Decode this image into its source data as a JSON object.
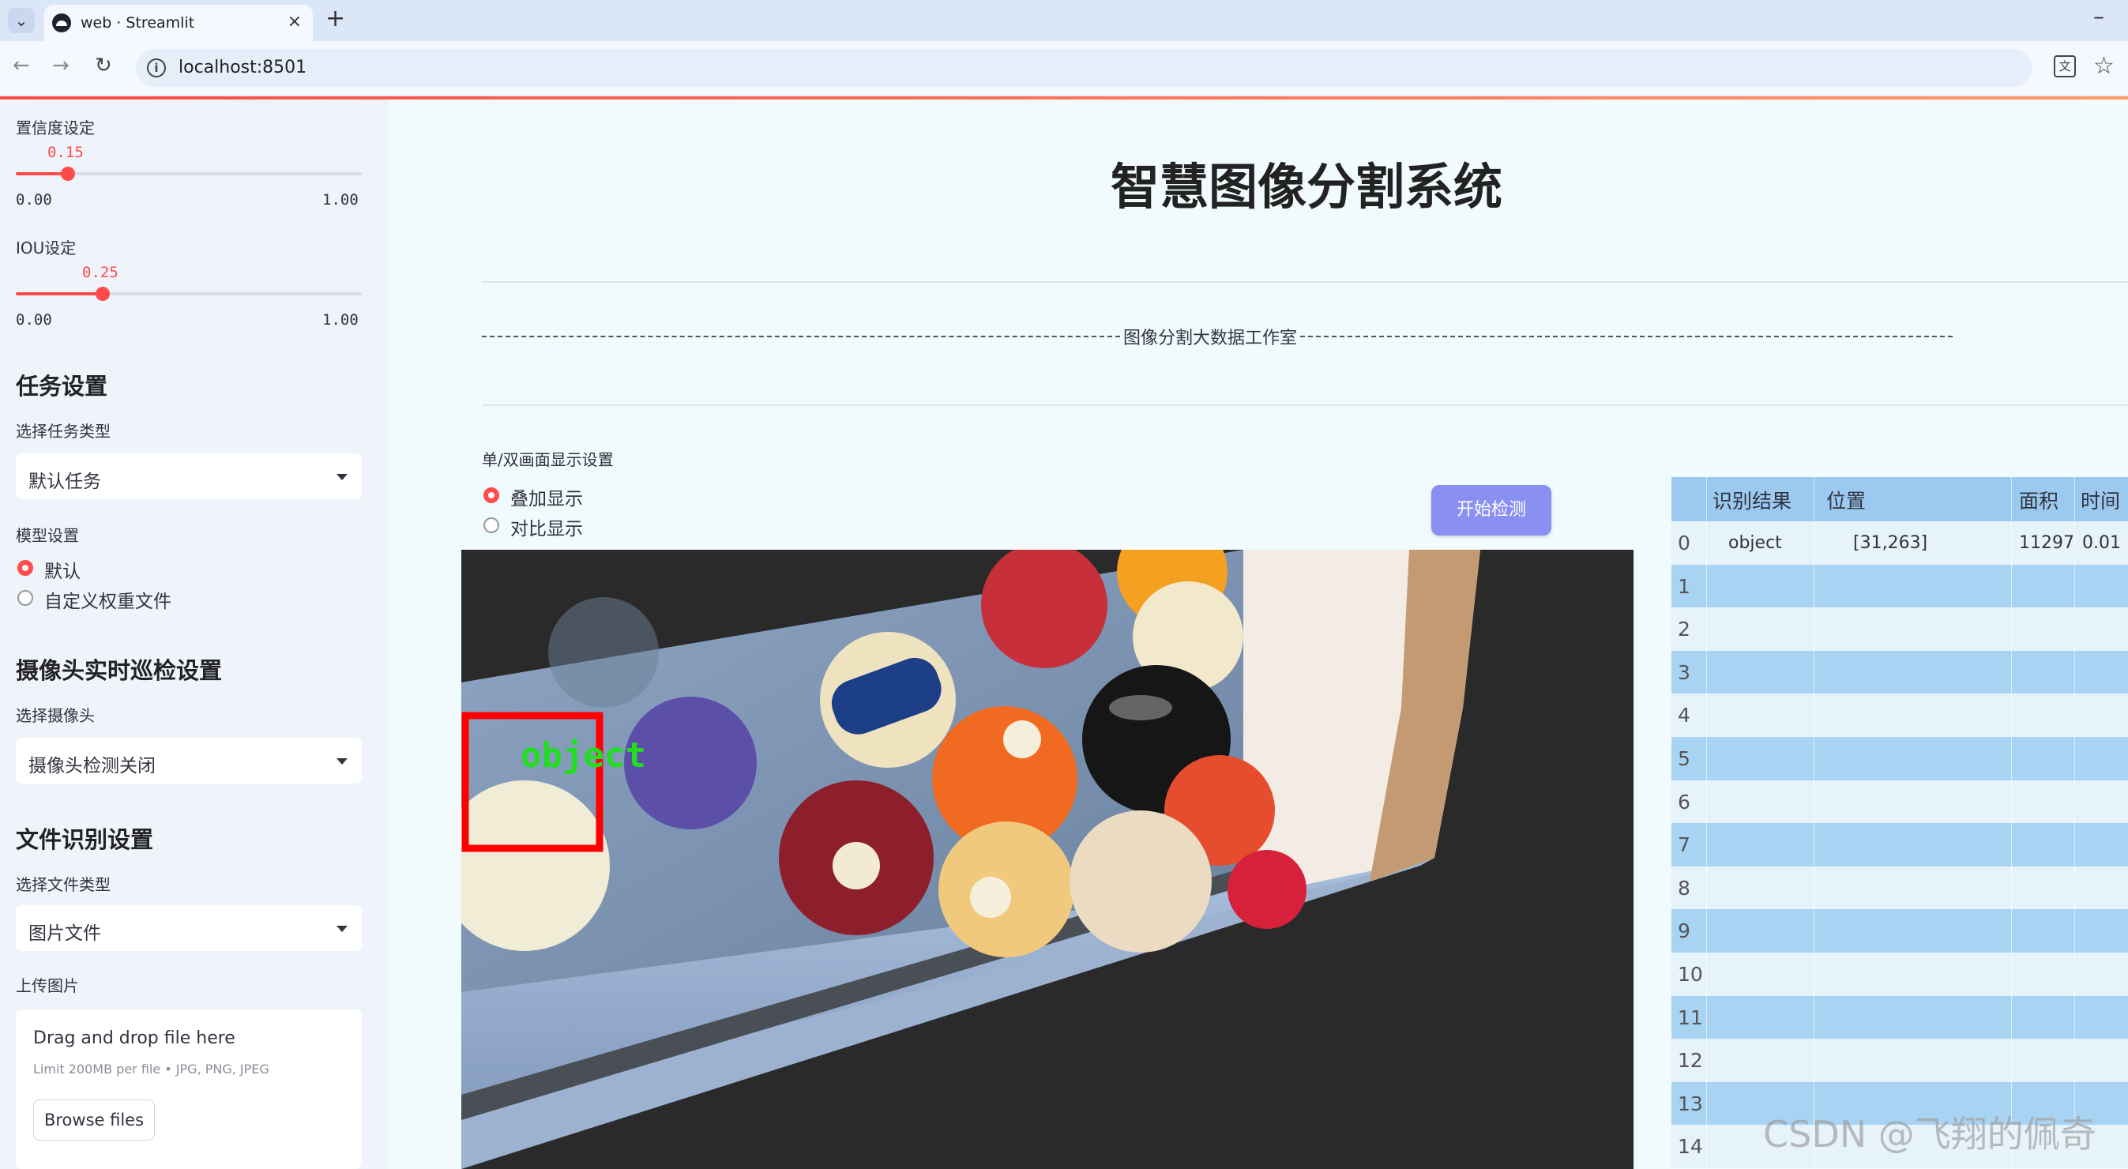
{
  "browser": {
    "tab_title": "web · Streamlit",
    "new_tab": "+",
    "close": "×",
    "url": "localhost:8501",
    "icons": [
      "tab-list-icon",
      "streamlit-favicon",
      "back-icon",
      "forward-icon",
      "reload-icon",
      "info-icon",
      "translate-icon",
      "star-icon",
      "minimize-icon"
    ]
  },
  "sidebar": {
    "confidence": {
      "label": "置信度设定",
      "value": "0.15",
      "min": "0.00",
      "max": "1.00",
      "fraction": 0.15
    },
    "iou": {
      "label": "IOU设定",
      "value": "0.25",
      "min": "0.00",
      "max": "1.00",
      "fraction": 0.25
    },
    "task_header": "任务设置",
    "task_type_label": "选择任务类型",
    "task_type_value": "默认任务",
    "model_label": "模型设置",
    "model_options": [
      "默认",
      "自定义权重文件"
    ],
    "model_selected": 0,
    "camera_header": "摄像头实时巡检设置",
    "camera_label": "选择摄像头",
    "camera_value": "摄像头检测关闭",
    "file_header": "文件识别设置",
    "file_type_label": "选择文件类型",
    "file_type_value": "图片文件",
    "upload_label": "上传图片",
    "dropzone_title": "Drag and drop file here",
    "dropzone_hint": "Limit 200MB per file • JPG, PNG, JPEG",
    "browse_button": "Browse files"
  },
  "main": {
    "title": "智慧图像分割系统",
    "banner": "图像分割大数据工作室",
    "display_mode_label": "单/双画面显示设置",
    "display_options": [
      "叠加显示",
      "对比显示"
    ],
    "display_selected": 0,
    "start_button": "开始检测",
    "detection_label": "object",
    "accent_color": "#ff4b4b",
    "button_color": "#8a8ff2"
  },
  "table": {
    "columns": [
      "识别结果",
      "位置",
      "面积",
      "时间"
    ],
    "rows": [
      {
        "idx": "0",
        "result": "object",
        "pos": "[31,263]",
        "area": "11297",
        "time": "0.01"
      },
      {
        "idx": "1"
      },
      {
        "idx": "2"
      },
      {
        "idx": "3"
      },
      {
        "idx": "4"
      },
      {
        "idx": "5"
      },
      {
        "idx": "6"
      },
      {
        "idx": "7"
      },
      {
        "idx": "8"
      },
      {
        "idx": "9"
      },
      {
        "idx": "10"
      },
      {
        "idx": "11"
      },
      {
        "idx": "12"
      },
      {
        "idx": "13"
      },
      {
        "idx": "14"
      }
    ]
  },
  "watermark": "CSDN @飞翔的佩奇"
}
